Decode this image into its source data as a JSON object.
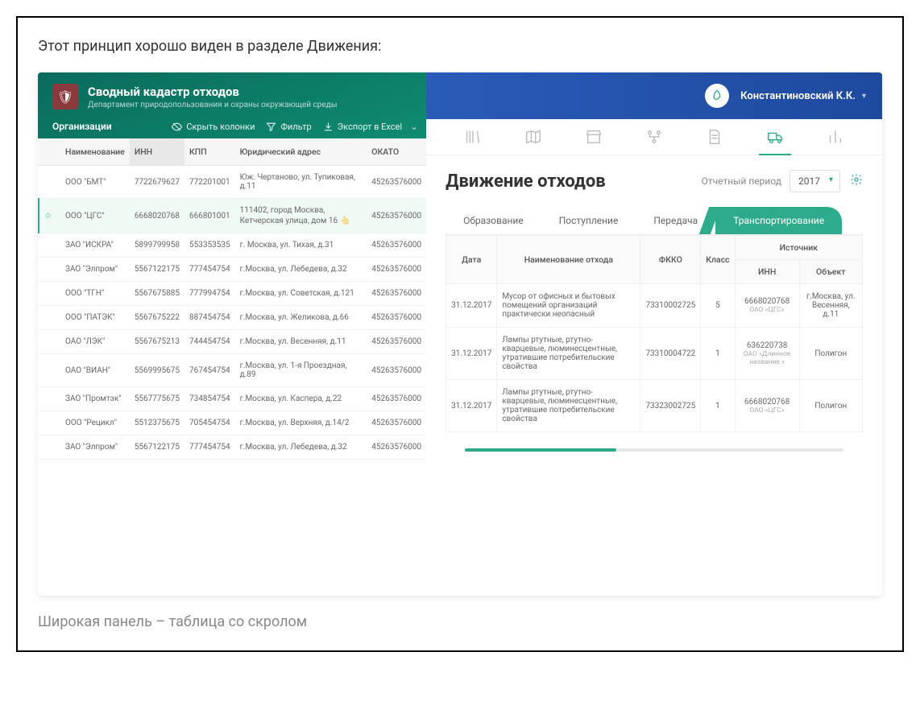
{
  "lead_text": "Этот принцип хорошо виден в разделе Движения:",
  "caption_text": "Широкая панель – таблица со скролом",
  "header": {
    "title": "Сводный кадастр отходов",
    "subtitle": "Департамент природопользования и охраны окружающей среды"
  },
  "user_name": "Константиновский К.К.",
  "left_panel": {
    "title": "Организации",
    "hide_cols": "Скрыть колонки",
    "filter": "Фильтр",
    "export": "Экспорт в Excel",
    "columns": [
      "Наименование",
      "ИНН",
      "КПП",
      "Юридический адрес",
      "ОКАТО"
    ],
    "rows": [
      {
        "star": false,
        "name": "ООО \"БМТ\"",
        "inn": "7722679627",
        "kpp": "772201001",
        "addr": "Юж. Чертаново, ул. Тупиковая, д.11",
        "okato": "45263576000",
        "sel": false
      },
      {
        "star": true,
        "name": "ООО \"ЦГС\"",
        "inn": "6668020768",
        "kpp": "666801001",
        "addr": "111402, город Москва, Кетчерская улица, дом 16",
        "okato": "45263576000",
        "sel": true
      },
      {
        "star": false,
        "name": "ЗАО \"ИСКРА\"",
        "inn": "5899799958",
        "kpp": "553353535",
        "addr": "г. Москва, ул. Тихая, д.31",
        "okato": "45263576000",
        "sel": false
      },
      {
        "star": false,
        "name": "ЗАО \"Элпром\"",
        "inn": "5567122175",
        "kpp": "777454754",
        "addr": "г.Москва, ул. Лебедева, д.32",
        "okato": "45263576000",
        "sel": false
      },
      {
        "star": false,
        "name": "ООО \"ТГН\"",
        "inn": "5567675885",
        "kpp": "777994754",
        "addr": "г.Москва, ул. Советская, д.121",
        "okato": "45263576000",
        "sel": false
      },
      {
        "star": false,
        "name": "ООО \"ПАТЭК\"",
        "inn": "5567675222",
        "kpp": "887454754",
        "addr": "г.Москва, ул. Желикова, д.66",
        "okato": "45263576000",
        "sel": false
      },
      {
        "star": false,
        "name": "ОАО \"ЛЭК\"",
        "inn": "5567675213",
        "kpp": "744454754",
        "addr": "г.Москва, ул. Весенняя, д.11",
        "okato": "45263576000",
        "sel": false
      },
      {
        "star": false,
        "name": "ОАО \"ВИАН\"",
        "inn": "5569995675",
        "kpp": "767454754",
        "addr": "г.Москва, ул. 1-я Проездная, д.89",
        "okato": "45263576000",
        "sel": false
      },
      {
        "star": false,
        "name": "ЗАО \"Промтэк\"",
        "inn": "5567775675",
        "kpp": "734854754",
        "addr": "г.Москва, ул. Каспера, д.22",
        "okato": "45263576000",
        "sel": false
      },
      {
        "star": false,
        "name": "ООО \"Рецикл\"",
        "inn": "5512375675",
        "kpp": "705454754",
        "addr": "г.Москва, ул. Верхняя, д.14/2",
        "okato": "45263576000",
        "sel": false
      },
      {
        "star": false,
        "name": "ЗАО \"Элпром\"",
        "inn": "5567122175",
        "kpp": "777454754",
        "addr": "г.Москва, ул. Лебедева, д.32",
        "okato": "45263576000",
        "sel": false
      }
    ]
  },
  "right_panel": {
    "title": "Движение отходов",
    "period_label": "Отчетный период",
    "year": "2017",
    "tabs": [
      "Образование",
      "Поступление",
      "Передача",
      "Транспортирование"
    ],
    "active_tab": 3,
    "headers": {
      "date": "Дата",
      "name": "Наименование отхода",
      "fkko": "ФККО",
      "class": "Класс",
      "source": "Источник",
      "inn": "ИНН",
      "object": "Объект"
    },
    "rows": [
      {
        "date": "31.12.2017",
        "name": "Мусор от офисных и бытовых помещений организаций практически неопасный",
        "fkko": "73310002725",
        "class": "5",
        "inn": "6668020768",
        "org": "ОАО «ЦГС»",
        "obj": "г.Москва, ул. Весенняя, д.11"
      },
      {
        "date": "31.12.2017",
        "name": "Лампы ртутные, ртутно-кварцевые, люминесцентные, утратившие потребительские свойства",
        "fkko": "73310004722",
        "class": "1",
        "inn": "636220738",
        "org": "ОАО «Длинное название »",
        "obj": "Полигон"
      },
      {
        "date": "31.12.2017",
        "name": "Лампы ртутные, ртутно-кварцевые, люминесцентные, утратившие потребительские свойства",
        "fkko": "73323002725",
        "class": "1",
        "inn": "6668020768",
        "org": "ОАО «ЦГС»",
        "obj": "Полигон"
      }
    ]
  }
}
